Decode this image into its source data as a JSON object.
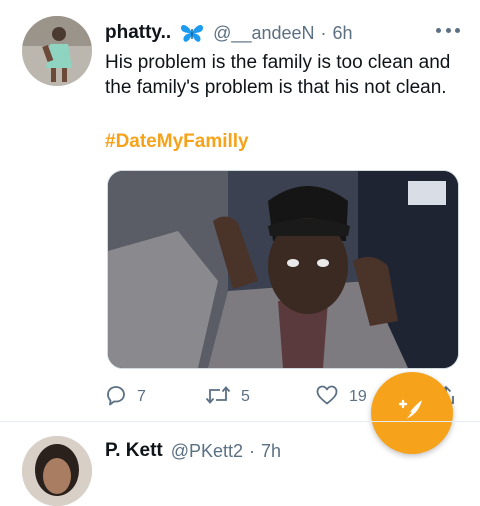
{
  "tweet": {
    "author_name": "phatty..",
    "badge_icon": "butterfly-icon",
    "handle": "@__andeeN",
    "separator": "·",
    "time": "6h",
    "text": "His problem is the family is too clean and the family's problem is that his not clean.",
    "hashtag": "#DateMyFamilly",
    "actions": {
      "reply_count": "7",
      "retweet_count": "5",
      "like_count": "19"
    }
  },
  "next_tweet": {
    "author_name": "P. Kett",
    "handle": "@PKett2",
    "separator": "·",
    "time": "7h"
  },
  "colors": {
    "accent": "#f7a21b",
    "secondary_text": "#5b7083",
    "primary_text": "#0f1419",
    "butterfly": "#1d9bf0"
  }
}
